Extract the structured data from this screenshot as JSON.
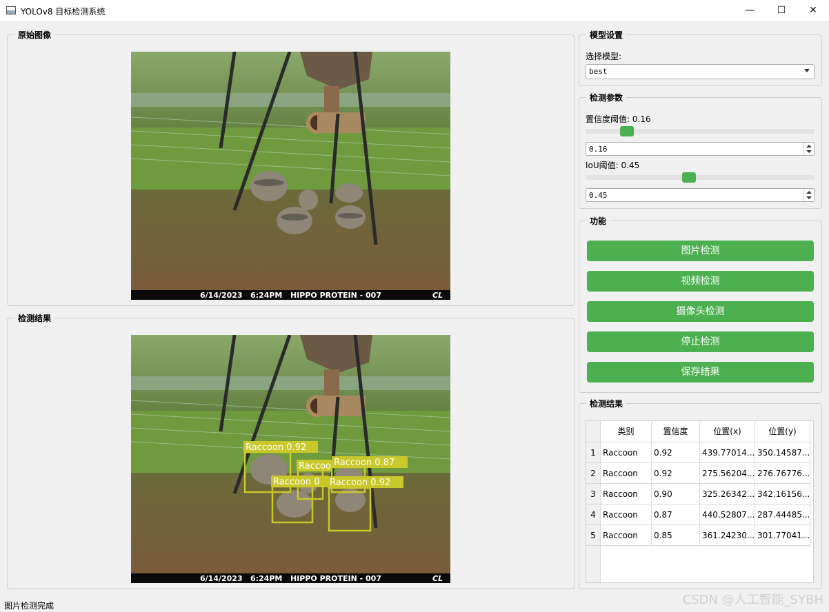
{
  "window": {
    "title": "YOLOv8 目标检测系统",
    "minimize": "—",
    "maximize": "☐",
    "close": "✕"
  },
  "original_panel": {
    "title": "原始图像"
  },
  "result_panel": {
    "title": "检测结果"
  },
  "photo": {
    "stamp_date": "6/14/2023",
    "stamp_time": "6:24PM",
    "stamp_text": "HIPPO PROTEIN - 007",
    "stamp_brand": "CL"
  },
  "boxes": [
    {
      "label": "Raccoon 0.92"
    },
    {
      "label": "Raccoon 0.87"
    },
    {
      "label": "Raccoo"
    },
    {
      "label": "Raccoon 0"
    },
    {
      "label": "Raccoon 0.92"
    }
  ],
  "model_settings": {
    "title": "模型设置",
    "select_label": "选择模型:",
    "selected_model": "best"
  },
  "detect_params": {
    "title": "检测参数",
    "conf_label": "置信度阈值: 0.16",
    "conf_value": "0.16",
    "conf_level": 0.16,
    "iou_label": "IoU阈值: 0.45",
    "iou_value": "0.45",
    "iou_level": 0.45
  },
  "functions": {
    "title": "功能",
    "image_detect": "图片检测",
    "video_detect": "视频检测",
    "camera_detect": "摄像头检测",
    "stop_detect": "停止检测",
    "save_result": "保存结果"
  },
  "results_table": {
    "title": "检测结果",
    "headers": [
      "类别",
      "置信度",
      "位置(x)",
      "位置(y)"
    ],
    "rows": [
      {
        "index": "1",
        "cls": "Raccoon",
        "conf": "0.92",
        "x": "439.77014...",
        "y": "350.14587..."
      },
      {
        "index": "2",
        "cls": "Raccoon",
        "conf": "0.92",
        "x": "275.56204...",
        "y": "276.76776..."
      },
      {
        "index": "3",
        "cls": "Raccoon",
        "conf": "0.90",
        "x": "325.26342...",
        "y": "342.16156..."
      },
      {
        "index": "4",
        "cls": "Raccoon",
        "conf": "0.87",
        "x": "440.52807...",
        "y": "287.44485..."
      },
      {
        "index": "5",
        "cls": "Raccoon",
        "conf": "0.85",
        "x": "361.24230...",
        "y": "301.77041..."
      }
    ]
  },
  "status": {
    "text": "图片检测完成"
  },
  "watermark": "CSDN @人工智能_SYBH",
  "colors": {
    "accent": "#4caf50",
    "box": "#c8c82a"
  }
}
